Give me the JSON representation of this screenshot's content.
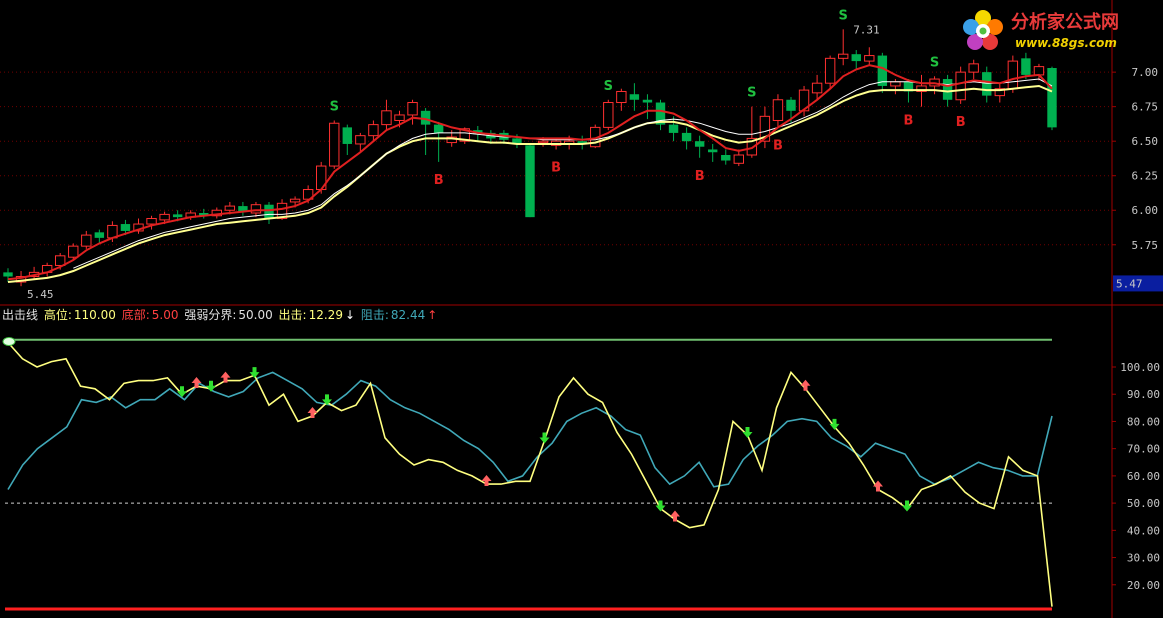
{
  "logo": {
    "title": "分析家公式网",
    "url": "www.88gs.com"
  },
  "legend": {
    "name": "出击线",
    "high_label": "高位:",
    "high_value": "110.00",
    "bottom_label": "底部:",
    "bottom_value": "5.00",
    "boundary_label": "强弱分界:",
    "boundary_value": "50.00",
    "attack_label": "出击:",
    "attack_value": "12.29",
    "attack_arrow": "↓",
    "resist_label": "阻击:",
    "resist_value": "82.44",
    "resist_arrow": "↑"
  },
  "colors": {
    "up": "#ff3030",
    "down": "#00b050",
    "ma_red": "#e02020",
    "ma_white": "#ffffff",
    "ma_yellow": "#ffff90",
    "attack_line": "#ffff80",
    "resist_line": "#40a8b8",
    "buy_text": "#e02020",
    "sell_text": "#20c040",
    "grid": "#700000"
  },
  "chart_data": [
    {
      "type": "candlestick",
      "ylim": [
        5.35,
        7.45
      ],
      "yticks": [
        "7.00",
        "6.75",
        "6.50",
        "6.25",
        "6.00",
        "5.75"
      ],
      "current_price_label": "5.47",
      "annotations": {
        "high": "7.31",
        "low": "5.45",
        "buy": "B",
        "sell": "S"
      },
      "candles": [
        [
          5.55,
          5.52,
          5.58,
          5.48
        ],
        [
          5.48,
          5.52,
          5.56,
          5.45
        ],
        [
          5.52,
          5.55,
          5.59,
          5.5
        ],
        [
          5.55,
          5.6,
          5.62,
          5.52
        ],
        [
          5.6,
          5.67,
          5.69,
          5.57
        ],
        [
          5.66,
          5.74,
          5.76,
          5.64
        ],
        [
          5.74,
          5.82,
          5.85,
          5.72
        ],
        [
          5.84,
          5.8,
          5.86,
          5.76
        ],
        [
          5.8,
          5.89,
          5.92,
          5.77
        ],
        [
          5.9,
          5.85,
          5.93,
          5.82
        ],
        [
          5.85,
          5.9,
          5.94,
          5.83
        ],
        [
          5.9,
          5.94,
          5.96,
          5.86
        ],
        [
          5.93,
          5.97,
          5.99,
          5.9
        ],
        [
          5.97,
          5.95,
          6.0,
          5.92
        ],
        [
          5.95,
          5.98,
          6.0,
          5.93
        ],
        [
          5.98,
          5.96,
          6.01,
          5.94
        ],
        [
          5.96,
          6.0,
          6.02,
          5.94
        ],
        [
          6.0,
          6.03,
          6.06,
          5.97
        ],
        [
          6.03,
          5.99,
          6.06,
          5.96
        ],
        [
          5.98,
          6.04,
          6.06,
          5.95
        ],
        [
          6.04,
          5.94,
          6.06,
          5.9
        ],
        [
          5.94,
          6.05,
          6.08,
          5.93
        ],
        [
          6.06,
          6.08,
          6.1,
          6.02
        ],
        [
          6.08,
          6.15,
          6.18,
          6.05
        ],
        [
          6.15,
          6.32,
          6.35,
          6.12
        ],
        [
          6.32,
          6.63,
          6.65,
          6.3
        ],
        [
          6.6,
          6.48,
          6.62,
          6.4
        ],
        [
          6.48,
          6.54,
          6.56,
          6.42
        ],
        [
          6.54,
          6.62,
          6.65,
          6.5
        ],
        [
          6.62,
          6.72,
          6.8,
          6.58
        ],
        [
          6.65,
          6.69,
          6.72,
          6.6
        ],
        [
          6.69,
          6.78,
          6.8,
          6.62
        ],
        [
          6.72,
          6.62,
          6.74,
          6.4
        ],
        [
          6.62,
          6.56,
          6.64,
          6.35
        ],
        [
          6.49,
          6.53,
          6.58,
          6.46
        ],
        [
          6.5,
          6.59,
          6.6,
          6.48
        ],
        [
          6.58,
          6.55,
          6.61,
          6.5
        ],
        [
          6.56,
          6.52,
          6.58,
          6.48
        ],
        [
          6.56,
          6.51,
          6.58,
          6.48
        ],
        [
          6.52,
          6.48,
          6.55,
          6.45
        ],
        [
          6.47,
          5.95,
          6.48,
          5.95
        ],
        [
          6.5,
          6.5,
          6.53,
          6.46
        ],
        [
          6.47,
          6.5,
          6.52,
          6.44
        ],
        [
          6.48,
          6.5,
          6.54,
          6.44
        ],
        [
          6.5,
          6.48,
          6.54,
          6.44
        ],
        [
          6.46,
          6.6,
          6.62,
          6.45
        ],
        [
          6.6,
          6.78,
          6.8,
          6.58
        ],
        [
          6.78,
          6.86,
          6.88,
          6.72
        ],
        [
          6.84,
          6.8,
          6.92,
          6.72
        ],
        [
          6.8,
          6.78,
          6.84,
          6.66
        ],
        [
          6.78,
          6.62,
          6.8,
          6.58
        ],
        [
          6.62,
          6.56,
          6.68,
          6.5
        ],
        [
          6.56,
          6.5,
          6.6,
          6.44
        ],
        [
          6.5,
          6.46,
          6.54,
          6.38
        ],
        [
          6.44,
          6.42,
          6.48,
          6.35
        ],
        [
          6.4,
          6.36,
          6.44,
          6.33
        ],
        [
          6.34,
          6.4,
          6.44,
          6.32
        ],
        [
          6.4,
          6.52,
          6.75,
          6.38
        ],
        [
          6.5,
          6.68,
          6.75,
          6.45
        ],
        [
          6.65,
          6.8,
          6.84,
          6.6
        ],
        [
          6.8,
          6.72,
          6.82,
          6.63
        ],
        [
          6.72,
          6.87,
          6.9,
          6.68
        ],
        [
          6.85,
          6.92,
          6.98,
          6.8
        ],
        [
          6.92,
          7.1,
          7.12,
          6.88
        ],
        [
          7.1,
          7.13,
          7.31,
          7.05
        ],
        [
          7.13,
          7.08,
          7.16,
          7.02
        ],
        [
          7.08,
          7.12,
          7.18,
          7.05
        ],
        [
          7.12,
          6.9,
          7.14,
          6.85
        ],
        [
          6.9,
          6.93,
          6.95,
          6.84
        ],
        [
          6.93,
          6.86,
          6.95,
          6.78
        ],
        [
          6.86,
          6.9,
          6.98,
          6.75
        ],
        [
          6.9,
          6.95,
          6.97,
          6.84
        ],
        [
          6.95,
          6.8,
          6.98,
          6.75
        ],
        [
          6.8,
          7.0,
          7.04,
          6.77
        ],
        [
          7.0,
          7.06,
          7.09,
          6.95
        ],
        [
          7.0,
          6.83,
          7.04,
          6.78
        ],
        [
          6.83,
          6.88,
          6.92,
          6.78
        ],
        [
          6.88,
          7.08,
          7.12,
          6.85
        ],
        [
          7.1,
          6.98,
          7.14,
          6.95
        ],
        [
          6.98,
          7.04,
          7.06,
          6.94
        ],
        [
          7.03,
          6.6,
          7.04,
          6.58
        ]
      ],
      "ma_fast": [
        5.5,
        5.51,
        5.53,
        5.55,
        5.59,
        5.64,
        5.71,
        5.76,
        5.8,
        5.83,
        5.86,
        5.89,
        5.91,
        5.93,
        5.95,
        5.96,
        5.97,
        5.98,
        5.99,
        6.0,
        6.0,
        6.01,
        6.03,
        6.07,
        6.15,
        6.28,
        6.35,
        6.42,
        6.5,
        6.58,
        6.62,
        6.67,
        6.66,
        6.63,
        6.6,
        6.58,
        6.56,
        6.55,
        6.54,
        6.53,
        6.52,
        6.52,
        6.52,
        6.52,
        6.51,
        6.52,
        6.56,
        6.62,
        6.68,
        6.72,
        6.72,
        6.7,
        6.65,
        6.58,
        6.52,
        6.45,
        6.43,
        6.45,
        6.52,
        6.6,
        6.66,
        6.73,
        6.8,
        6.88,
        6.97,
        7.02,
        7.05,
        7.03,
        6.98,
        6.94,
        6.92,
        6.92,
        6.9,
        6.92,
        6.94,
        6.93,
        6.92,
        6.95,
        6.97,
        6.98,
        6.88
      ],
      "ma_mid": [
        null,
        null,
        null,
        null,
        null,
        5.58,
        5.62,
        5.66,
        5.7,
        5.74,
        5.78,
        5.81,
        5.84,
        5.86,
        5.88,
        5.9,
        5.92,
        5.94,
        5.95,
        5.96,
        5.97,
        5.97,
        5.98,
        6.0,
        6.04,
        6.12,
        6.18,
        6.25,
        6.33,
        6.41,
        6.47,
        6.52,
        6.55,
        6.56,
        6.56,
        6.56,
        6.55,
        6.54,
        6.53,
        6.53,
        6.52,
        6.51,
        6.51,
        6.51,
        6.51,
        6.51,
        6.53,
        6.56,
        6.6,
        6.63,
        6.65,
        6.66,
        6.65,
        6.63,
        6.6,
        6.57,
        6.55,
        6.55,
        6.57,
        6.6,
        6.63,
        6.67,
        6.71,
        6.76,
        6.82,
        6.87,
        6.91,
        6.93,
        6.93,
        6.93,
        6.92,
        6.92,
        6.91,
        6.92,
        6.93,
        6.92,
        6.92,
        6.93,
        6.94,
        6.95,
        6.9
      ],
      "ma_slow": [
        5.48,
        5.49,
        5.5,
        5.51,
        5.53,
        5.56,
        5.6,
        5.64,
        5.68,
        5.72,
        5.76,
        5.79,
        5.82,
        5.84,
        5.86,
        5.88,
        5.9,
        5.91,
        5.92,
        5.93,
        5.94,
        5.95,
        5.96,
        5.98,
        6.02,
        6.1,
        6.17,
        6.25,
        6.33,
        6.41,
        6.46,
        6.5,
        6.52,
        6.52,
        6.52,
        6.51,
        6.5,
        6.49,
        6.49,
        6.48,
        6.48,
        6.48,
        6.48,
        6.48,
        6.48,
        6.49,
        6.52,
        6.56,
        6.6,
        6.63,
        6.64,
        6.64,
        6.62,
        6.58,
        6.54,
        6.51,
        6.49,
        6.5,
        6.53,
        6.57,
        6.61,
        6.65,
        6.69,
        6.74,
        6.79,
        6.83,
        6.86,
        6.87,
        6.87,
        6.87,
        6.87,
        6.87,
        6.86,
        6.87,
        6.88,
        6.87,
        6.87,
        6.88,
        6.89,
        6.9,
        6.86
      ],
      "buy_signals": [
        33,
        42,
        53,
        59,
        69,
        73
      ],
      "sell_signals": [
        25,
        46,
        57,
        64,
        71
      ]
    },
    {
      "type": "line",
      "ylim": [
        10,
        118
      ],
      "yticks": [
        "100.00",
        "90.00",
        "80.00",
        "70.00",
        "60.00",
        "50.00",
        "40.00",
        "30.00",
        "20.00"
      ],
      "high_level": 110,
      "bottom_level": 5,
      "boundary_level": 50,
      "series": [
        {
          "name": "出击",
          "values": [
            109,
            103,
            100,
            102,
            103,
            93,
            92,
            88,
            94,
            95,
            95,
            96,
            90,
            93,
            92,
            95,
            95,
            97,
            86,
            90,
            80,
            82,
            87,
            84,
            86,
            94,
            74,
            68,
            64,
            66,
            65,
            62,
            60,
            57,
            57,
            58,
            58,
            73,
            89,
            96,
            90,
            87,
            76,
            68,
            58,
            48,
            44,
            41,
            42,
            55,
            80,
            75,
            62,
            85,
            98,
            92,
            85,
            78,
            72,
            64,
            55,
            52,
            48,
            55,
            57,
            60,
            54,
            50,
            48,
            67,
            62,
            60,
            12
          ]
        },
        {
          "name": "阻击",
          "values": [
            55,
            64,
            70,
            74,
            78,
            88,
            87,
            89,
            85,
            88,
            88,
            92,
            88,
            94,
            91,
            89,
            91,
            96,
            98,
            95,
            92,
            87,
            86,
            90,
            95,
            93,
            88,
            85,
            83,
            80,
            77,
            73,
            70,
            65,
            58,
            60,
            67,
            72,
            80,
            83,
            85,
            82,
            77,
            75,
            63,
            57,
            60,
            65,
            56,
            57,
            66,
            71,
            75,
            80,
            81,
            80,
            74,
            71,
            67,
            72,
            70,
            68,
            60,
            57,
            59,
            62,
            65,
            63,
            62,
            60,
            60,
            82
          ]
        }
      ],
      "down_arrows": [
        12,
        14,
        17,
        22,
        37,
        45,
        51,
        57,
        62
      ],
      "up_arrows": [
        13,
        15,
        21,
        33,
        46,
        55,
        60
      ]
    }
  ]
}
